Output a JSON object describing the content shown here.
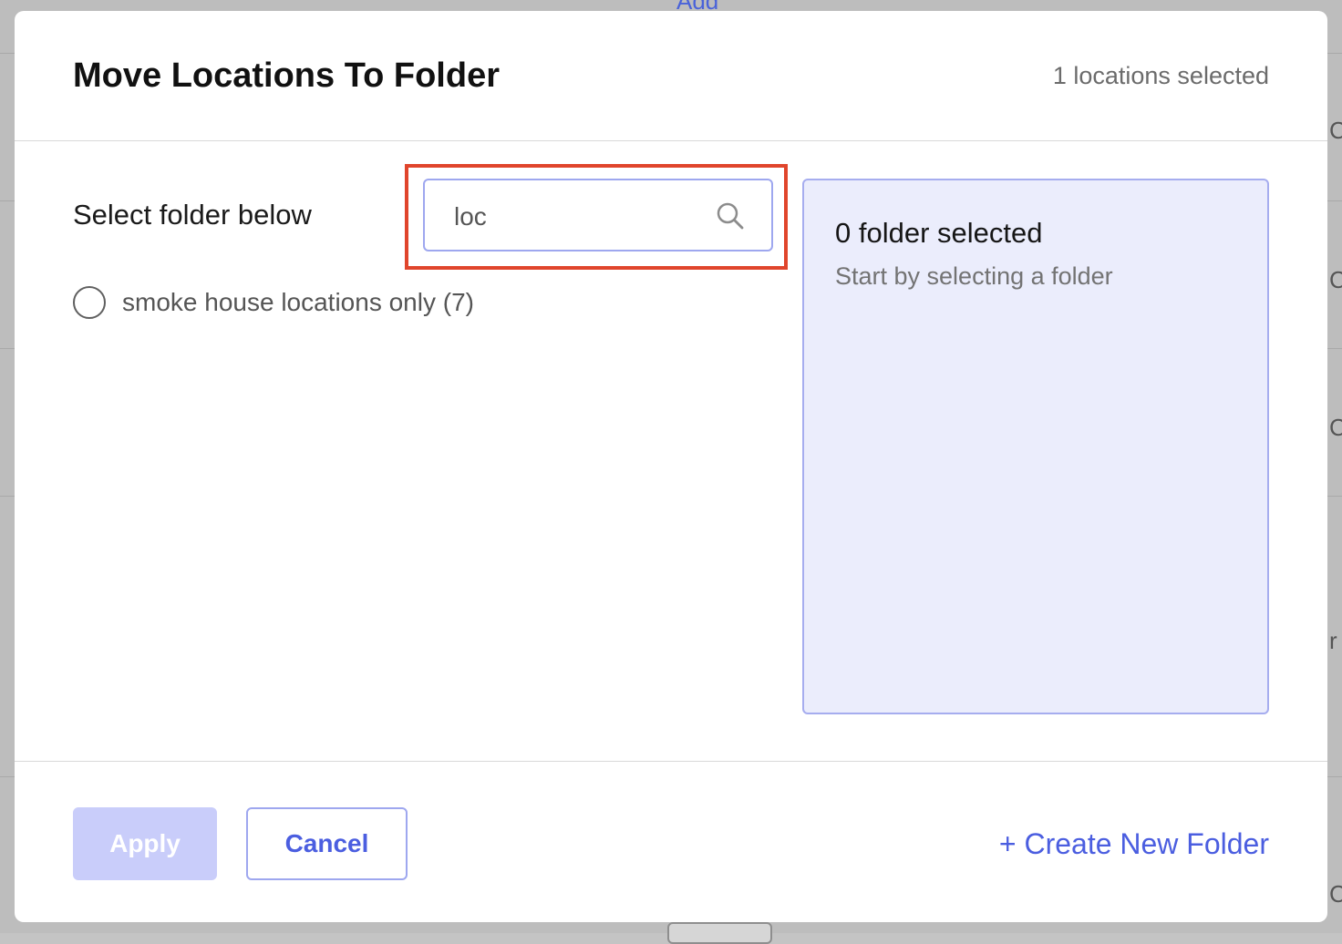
{
  "background": {
    "top_fragment": "Add",
    "right_fragments": [
      "C",
      "C",
      "C",
      "r",
      "C"
    ]
  },
  "modal": {
    "title": "Move Locations To Folder",
    "selected_count": "1 locations selected",
    "select_label": "Select folder below",
    "search": {
      "value": "loc",
      "placeholder": ""
    },
    "folders": [
      {
        "label": "smoke house locations only (7)",
        "selected": false
      }
    ],
    "selection_panel": {
      "title": "0 folder selected",
      "subtitle": "Start by selecting a folder"
    },
    "footer": {
      "apply_label": "Apply",
      "cancel_label": "Cancel",
      "create_label": "+ Create New Folder"
    }
  },
  "colors": {
    "accent": "#4b5ee0",
    "apply_disabled_bg": "#c9cdfa",
    "panel_bg": "#ebedfc",
    "highlight": "#e0452c"
  },
  "icons": {
    "search": "search-icon",
    "radio": "radio-unchecked-icon"
  }
}
